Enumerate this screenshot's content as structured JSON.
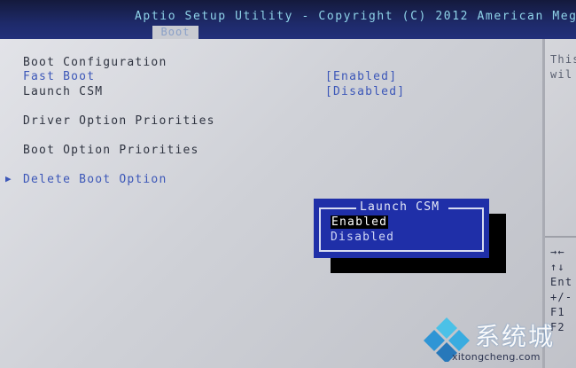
{
  "header": {
    "title": "Aptio Setup Utility - Copyright (C) 2012 American Meg",
    "active_tab": "Boot"
  },
  "menu": {
    "section_title": "Boot Configuration",
    "items": [
      {
        "label": "Fast Boot",
        "value": "[Enabled]"
      },
      {
        "label": "Launch CSM",
        "value": "[Disabled]"
      },
      {
        "label": "Driver Option Priorities"
      },
      {
        "label": "Boot Option Priorities"
      },
      {
        "label": "Delete Boot Option"
      }
    ]
  },
  "help_panel": {
    "lines": [
      "This",
      "wil"
    ]
  },
  "nav_keys": [
    "→←",
    "↑↓",
    "Ent",
    "+/-",
    "F1",
    "F2"
  ],
  "popup": {
    "title": "Launch CSM",
    "options": [
      "Enabled",
      "Disabled"
    ],
    "selected": "Enabled"
  },
  "watermark": {
    "cn_text": "系统城",
    "url": "xitongcheng.com"
  },
  "colors": {
    "header_bg": "#1e2a6a",
    "title_text": "#8fd3e8",
    "panel_bg": "#cfd1d7",
    "accent_blue": "#3c57b8",
    "popup_bg": "#1f2fa8"
  }
}
